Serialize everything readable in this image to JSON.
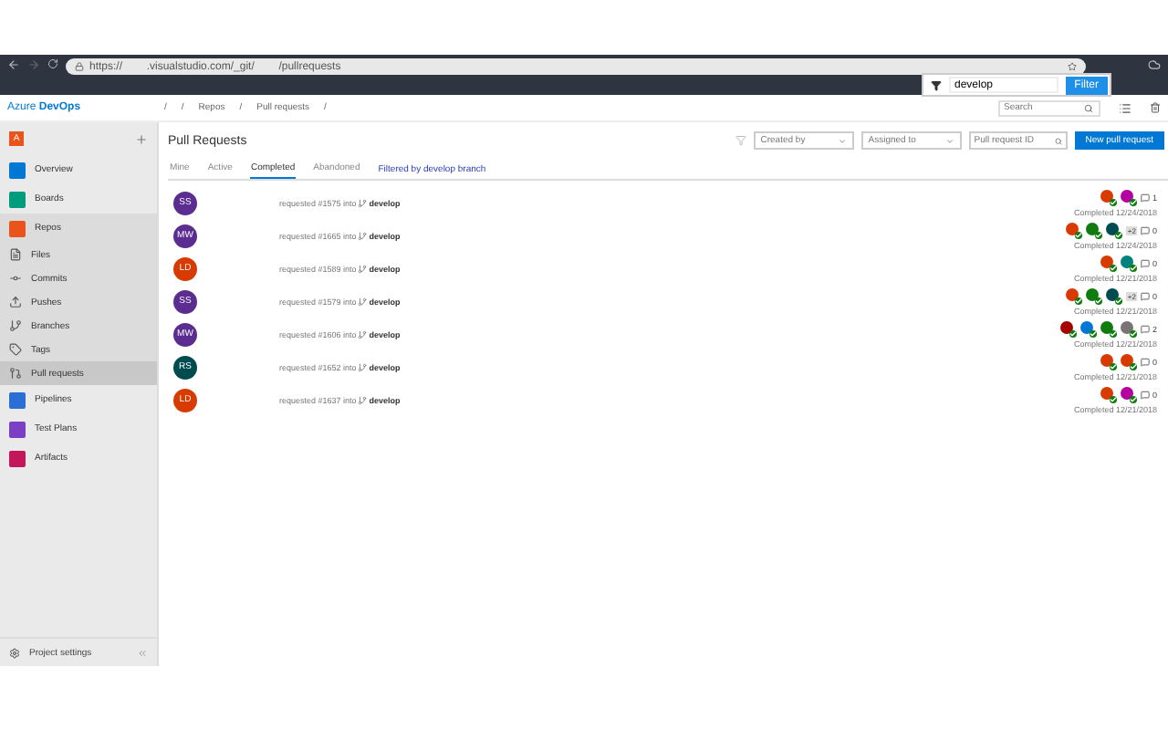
{
  "browser": {
    "url": "https://        .visualstudio.com/_git/        /pullrequests"
  },
  "filter_popup": {
    "value": "develop",
    "button": "Filter"
  },
  "header": {
    "brand": "Azure",
    "brand_bold": "DevOps",
    "breadcrumbs": [
      "/",
      "/",
      "Repos",
      "/",
      "Pull requests",
      "/"
    ],
    "search": {
      "placeholder": "Search"
    }
  },
  "sidebar": {
    "org": "A",
    "items": [
      {
        "label": "Overview",
        "kind": "section",
        "selected": false,
        "color": "#0078d4"
      },
      {
        "label": "Boards",
        "kind": "section",
        "selected": false,
        "color": "#009c7e"
      },
      {
        "label": "Repos",
        "kind": "section",
        "selected": false,
        "color": "#e8541c",
        "children": [
          {
            "label": "Files",
            "kind": "sub",
            "selected": false
          },
          {
            "label": "Commits",
            "kind": "sub",
            "selected": false
          },
          {
            "label": "Pushes",
            "kind": "sub",
            "selected": false
          },
          {
            "label": "Branches",
            "kind": "sub",
            "selected": false
          },
          {
            "label": "Tags",
            "kind": "sub",
            "selected": false
          },
          {
            "label": "Pull requests",
            "kind": "sub",
            "selected": true
          }
        ]
      },
      {
        "label": "Pipelines",
        "kind": "section",
        "selected": false,
        "color": "#2b6fd6"
      },
      {
        "label": "Test Plans",
        "kind": "section",
        "selected": false,
        "color": "#7b3fc4"
      },
      {
        "label": "Artifacts",
        "kind": "section",
        "selected": false,
        "color": "#c2185b"
      }
    ],
    "footer": "Project settings"
  },
  "page": {
    "title": "Pull Requests",
    "tabs": [
      {
        "label": "Mine",
        "selected": false
      },
      {
        "label": "Active",
        "selected": false
      },
      {
        "label": "Completed",
        "selected": true
      },
      {
        "label": "Abandoned",
        "selected": false
      }
    ],
    "filter_note": "Filtered by develop branch",
    "filters": [
      {
        "placeholder": "Created by"
      },
      {
        "placeholder": "Assigned to"
      }
    ],
    "id_search": {
      "placeholder": "Pull request ID"
    },
    "new_button": "New pull request"
  },
  "pull_requests": [
    {
      "initials": "SS",
      "color": "#5c2d91",
      "text": "requested #1575 into",
      "branch": "develop",
      "reviewers": [
        {
          "color": "#d83b01"
        },
        {
          "color": "#b4009e"
        }
      ],
      "comments": "1",
      "status": "Completed 12/24/2018"
    },
    {
      "initials": "MW",
      "color": "#5c2d91",
      "text": "requested #1665 into",
      "branch": "develop",
      "reviewers": [
        {
          "color": "#d83b01"
        },
        {
          "color": "#107c10"
        },
        {
          "color": "#004b50"
        }
      ],
      "more": "+2",
      "comments": "0",
      "status": "Completed 12/24/2018"
    },
    {
      "initials": "LD",
      "color": "#d83b01",
      "text": "requested #1589 into",
      "branch": "develop",
      "reviewers": [
        {
          "color": "#d83b01"
        },
        {
          "color": "#00827f"
        }
      ],
      "comments": "0",
      "status": "Completed 12/21/2018"
    },
    {
      "initials": "SS",
      "color": "#5c2d91",
      "text": "requested #1579 into",
      "branch": "develop",
      "reviewers": [
        {
          "color": "#d83b01"
        },
        {
          "color": "#107c10"
        },
        {
          "color": "#004b50"
        }
      ],
      "more": "+2",
      "comments": "0",
      "status": "Completed 12/21/2018"
    },
    {
      "initials": "MW",
      "color": "#5c2d91",
      "text": "requested #1606 into",
      "branch": "develop",
      "reviewers": [
        {
          "color": "#a80000"
        },
        {
          "color": "#0078d4"
        },
        {
          "color": "#107c10"
        },
        {
          "color": "#7a7574"
        }
      ],
      "comments": "2",
      "status": "Completed 12/21/2018"
    },
    {
      "initials": "RS",
      "color": "#004b50",
      "text": "requested #1652 into",
      "branch": "develop",
      "reviewers": [
        {
          "color": "#d83b01"
        },
        {
          "color": "#d83b01"
        }
      ],
      "comments": "0",
      "status": "Completed 12/21/2018"
    },
    {
      "initials": "LD",
      "color": "#d83b01",
      "text": "requested #1637 into",
      "branch": "develop",
      "reviewers": [
        {
          "color": "#d83b01"
        },
        {
          "color": "#b4009e"
        }
      ],
      "comments": "0",
      "status": "Completed 12/21/2018"
    }
  ]
}
